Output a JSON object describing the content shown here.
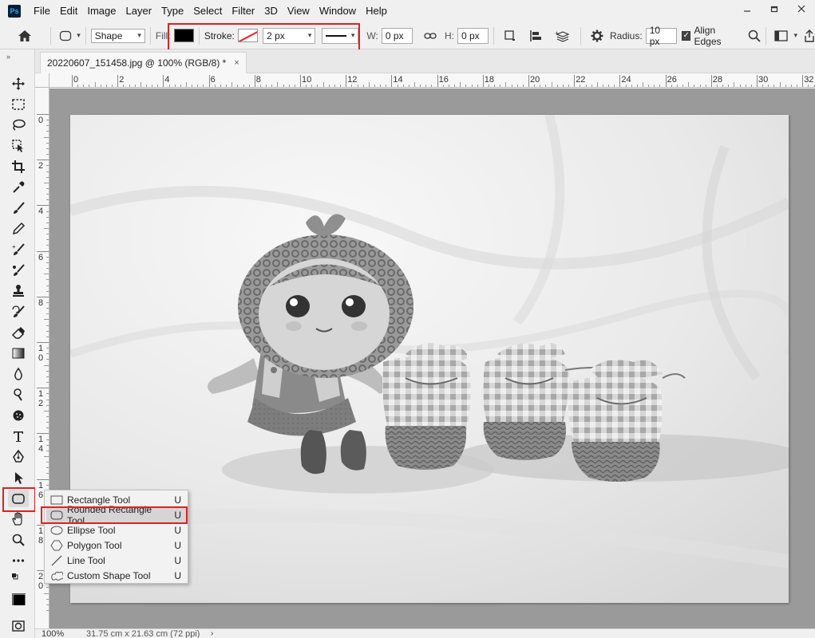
{
  "app": {
    "logo_text": "Ps",
    "menu": [
      "File",
      "Edit",
      "Image",
      "Layer",
      "Type",
      "Select",
      "Filter",
      "3D",
      "View",
      "Window",
      "Help"
    ]
  },
  "options": {
    "mode": "Shape",
    "fill_label": "Fill:",
    "stroke_label": "Stroke:",
    "stroke_width": "2 px",
    "w_label": "W:",
    "w_value": "0 px",
    "h_label": "H:",
    "h_value": "0 px",
    "radius_label": "Radius:",
    "radius_value": "10 px",
    "align_edges_label": "Align Edges",
    "fill_color": "#000000",
    "stroke_color": "#e22222"
  },
  "document": {
    "tab_title": "20220607_151458.jpg @ 100% (RGB/8) *",
    "close": "×"
  },
  "rulers": {
    "top": [
      "0",
      "2",
      "4",
      "6",
      "8",
      "10",
      "12",
      "14",
      "16",
      "18",
      "20",
      "22",
      "24",
      "26",
      "28",
      "30",
      "32"
    ],
    "left": [
      "0",
      "2",
      "4",
      "6",
      "8",
      "10",
      "12",
      "14",
      "16",
      "18",
      "20"
    ]
  },
  "status": {
    "zoom": "100%",
    "doc_size": "31.75 cm x 21.63 cm (72 ppi)",
    "arrow": "›"
  },
  "flyout": {
    "items": [
      {
        "label": "Rectangle Tool",
        "key": "U",
        "icon": "rectangle-icon"
      },
      {
        "label": "Rounded Rectangle Tool",
        "key": "U",
        "icon": "rounded-rectangle-icon"
      },
      {
        "label": "Ellipse Tool",
        "key": "U",
        "icon": "ellipse-icon"
      },
      {
        "label": "Polygon Tool",
        "key": "U",
        "icon": "polygon-icon"
      },
      {
        "label": "Line Tool",
        "key": "U",
        "icon": "line-icon"
      },
      {
        "label": "Custom Shape Tool",
        "key": "U",
        "icon": "custom-shape-icon"
      }
    ],
    "selected_index": 1
  },
  "highlight_color": "#d22222"
}
